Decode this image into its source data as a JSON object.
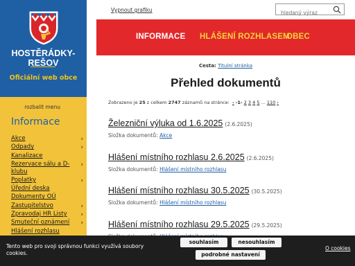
{
  "brand": {
    "village_name": "HOSTĚRÁDKY-REŠOV",
    "tagline": "Oficiální web obce"
  },
  "sidebar": {
    "expand_label": "rozbalit menu",
    "title": "Informace",
    "items": [
      {
        "label": "Akce",
        "has_submenu": true
      },
      {
        "label": "Odpady",
        "has_submenu": true
      },
      {
        "label": "Kanalizace",
        "has_submenu": false
      },
      {
        "label": "Rezervace sálu a D-klubu",
        "has_submenu": true
      },
      {
        "label": "Poplatky",
        "has_submenu": true
      },
      {
        "label": "Úřední deska",
        "has_submenu": false
      },
      {
        "label": "Dokumenty OÚ",
        "has_submenu": false
      },
      {
        "label": "Zastupitelstvo",
        "has_submenu": true
      },
      {
        "label": "Zpravodaj HR Listy",
        "has_submenu": true
      },
      {
        "label": "Smuteční oznámení",
        "has_submenu": true
      },
      {
        "label": "Hlášení rozhlasu",
        "has_submenu": false
      }
    ]
  },
  "topbar": {
    "toggle_graphics": "Vypnout grafiku",
    "search_placeholder": "hledaný výraz"
  },
  "nav": {
    "items": [
      "INFORMACE",
      "HLÁŠENÍ ROZHLASEM",
      "OBEC"
    ]
  },
  "breadcrumb": {
    "label": "Cesta:",
    "current": "Titulní stránka"
  },
  "page": {
    "title": "Přehled dokumentů"
  },
  "pager": {
    "prefix": "Zobrazeno je",
    "shown": "25",
    "middle": "z celkem",
    "total": "2747",
    "suffix": "záznamů na stránce:",
    "prev": "‹",
    "pages": [
      "-1-",
      "2",
      "3",
      "4",
      "5",
      "...",
      "110"
    ],
    "next": "›"
  },
  "documents": [
    {
      "title": "Železniční výluka od 1.6.2025",
      "date": "(2.6.2025)",
      "folder_label": "Složka dokumentů:",
      "folder": "Akce"
    },
    {
      "title": "Hlášení místního rozhlasu 2.6.2025",
      "date": "(2.6.2025)",
      "folder_label": "Složka dokumentů:",
      "folder": "Hlášení místního rozhlasu"
    },
    {
      "title": "Hlášení místního rozhlasu 30.5.2025",
      "date": "(30.5.2025)",
      "folder_label": "Složka dokumentů:",
      "folder": "Hlášení místního rozhlasu"
    },
    {
      "title": "Hlášení místního rozhlasu 29.5.2025",
      "date": "(29.5.2025)",
      "folder_label": "Složka dokumentů:",
      "folder": "Hlášení místního rozhlasu"
    }
  ],
  "cookie": {
    "text": "Tento web pro svoji správnou funkci využívá soubory cookies.",
    "accept": "souhlasím",
    "reject": "nesouhlasím",
    "settings": "podrobné nastavení",
    "more_link": "O cookies"
  },
  "colors": {
    "brand_blue": "#1f5fa3",
    "sidebar_yellow": "#f2c33a",
    "nav_red": "#e2282b",
    "nav_yellow_text": "#f8d23c",
    "cookie_bg": "#1e1e1e"
  },
  "icons": {
    "crest": "coat-of-arms-icon",
    "search": "search-icon",
    "submenu": "chevron-right-icon"
  }
}
